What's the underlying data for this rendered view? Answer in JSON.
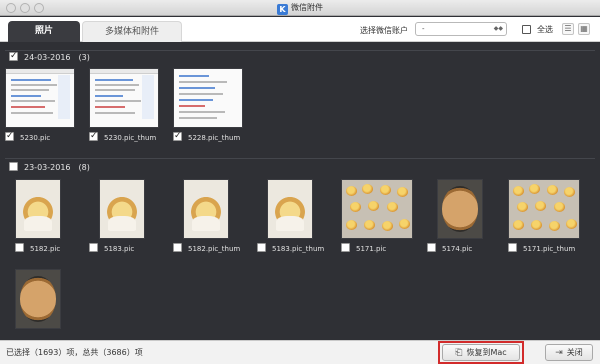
{
  "window": {
    "title": "微信附件",
    "app_icon_letter": "K"
  },
  "toolbar": {
    "tabs": [
      {
        "label": "照片"
      },
      {
        "label": "多媒体和附件"
      }
    ],
    "account_label": "选择微信账户",
    "account_value": "-",
    "account_arrows": "◆◆",
    "select_all_label": "全选"
  },
  "groups": [
    {
      "date": "24-03-2016",
      "count": "(3)",
      "items": [
        {
          "name": "5230.pic"
        },
        {
          "name": "5230.pic_thum"
        },
        {
          "name": "5228.pic_thum"
        }
      ]
    },
    {
      "date": "23-03-2016",
      "count": "(8)",
      "items": [
        {
          "name": "5182.pic"
        },
        {
          "name": "5183.pic"
        },
        {
          "name": "5182.pic_thum"
        },
        {
          "name": "5183.pic_thum"
        },
        {
          "name": "5171.pic"
        },
        {
          "name": "5174.pic"
        },
        {
          "name": "5171.pic_thum"
        },
        {
          "name": ""
        }
      ]
    }
  ],
  "status": {
    "text": "已选择（1693）项，总共（3686）项"
  },
  "buttons": {
    "restore": "恢复到Mac",
    "close": "关闭"
  },
  "colors": {
    "content_bg": "#2f3035",
    "active_tab": "#3a3b40",
    "highlight": "#d22b2b",
    "link_blue": "#3a7bd5"
  }
}
